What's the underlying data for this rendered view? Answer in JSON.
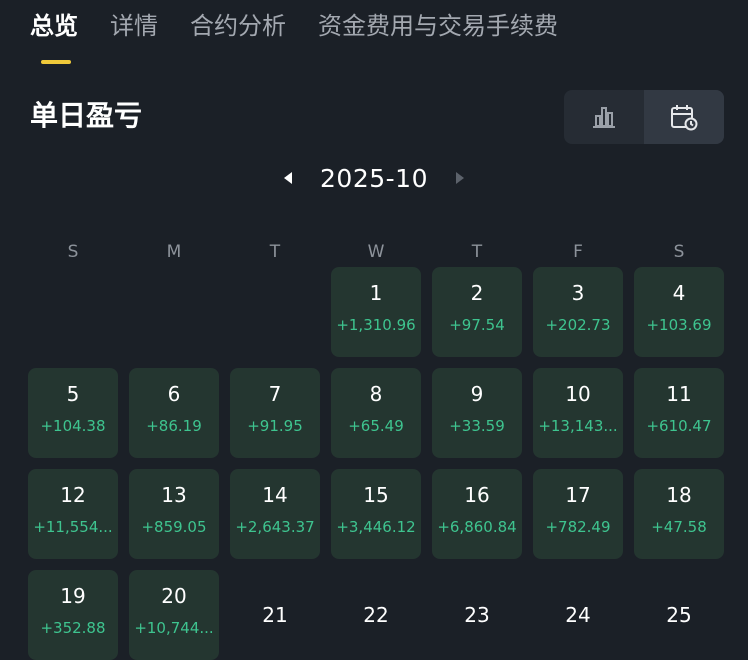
{
  "tabs": [
    {
      "label": "总览",
      "active": true
    },
    {
      "label": "详情",
      "active": false
    },
    {
      "label": "合约分析",
      "active": false
    },
    {
      "label": "资金费用与交易手续费",
      "active": false
    }
  ],
  "section": {
    "title": "单日盈亏",
    "view_toggle": [
      {
        "icon": "bar-chart-icon",
        "active": false
      },
      {
        "icon": "calendar-icon",
        "active": true
      }
    ]
  },
  "calendar": {
    "month": "2025-10",
    "weekdays": [
      "S",
      "M",
      "T",
      "W",
      "T",
      "F",
      "S"
    ],
    "leading_blanks": 3,
    "days": [
      {
        "day": "1",
        "pnl": "+1,310.96"
      },
      {
        "day": "2",
        "pnl": "+97.54"
      },
      {
        "day": "3",
        "pnl": "+202.73"
      },
      {
        "day": "4",
        "pnl": "+103.69"
      },
      {
        "day": "5",
        "pnl": "+104.38"
      },
      {
        "day": "6",
        "pnl": "+86.19"
      },
      {
        "day": "7",
        "pnl": "+91.95"
      },
      {
        "day": "8",
        "pnl": "+65.49"
      },
      {
        "day": "9",
        "pnl": "+33.59"
      },
      {
        "day": "10",
        "pnl": "+13,143..."
      },
      {
        "day": "11",
        "pnl": "+610.47"
      },
      {
        "day": "12",
        "pnl": "+11,554..."
      },
      {
        "day": "13",
        "pnl": "+859.05"
      },
      {
        "day": "14",
        "pnl": "+2,643.37"
      },
      {
        "day": "15",
        "pnl": "+3,446.12"
      },
      {
        "day": "16",
        "pnl": "+6,860.84"
      },
      {
        "day": "17",
        "pnl": "+782.49"
      },
      {
        "day": "18",
        "pnl": "+47.58"
      },
      {
        "day": "19",
        "pnl": "+352.88"
      },
      {
        "day": "20",
        "pnl": "+10,744..."
      },
      {
        "day": "21",
        "pnl": null
      },
      {
        "day": "22",
        "pnl": null
      },
      {
        "day": "23",
        "pnl": null
      },
      {
        "day": "24",
        "pnl": null
      },
      {
        "day": "25",
        "pnl": null
      }
    ]
  },
  "colors": {
    "background": "#1b2027",
    "accent": "#f0c93a",
    "profit": "#3ec48f",
    "cell_bg": "#243630"
  }
}
